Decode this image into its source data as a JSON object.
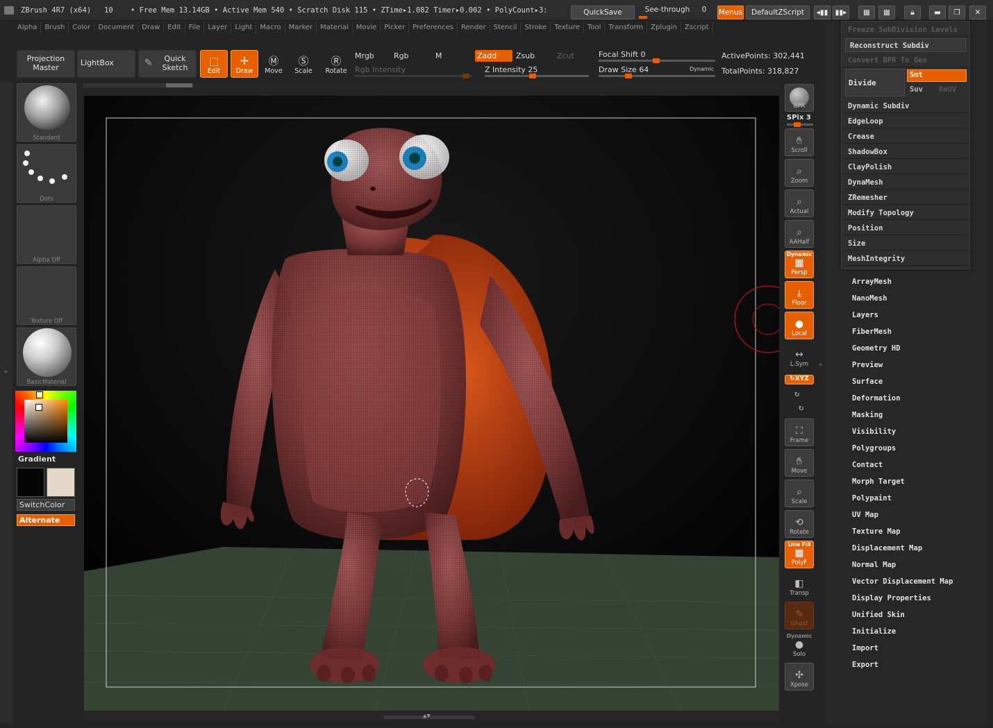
{
  "titlebar": {
    "text": "ZBrush 4R7 (x64)   10    • Free Mem 13.14GB • Active Mem 540 • Scratch Disk 115 • ZTime▸1.082 Timer▸0.002 • PolyCount▸3:",
    "quicksave": "QuickSave",
    "see_through": "See-through",
    "see_through_value": "0",
    "menus": "Menus",
    "default_zscript": "DefaultZScript"
  },
  "menubar": [
    "Alpha",
    "Brush",
    "Color",
    "Document",
    "Draw",
    "Edit",
    "File",
    "Layer",
    "Light",
    "Macro",
    "Marker",
    "Material",
    "Movie",
    "Picker",
    "Preferences",
    "Render",
    "Stencil",
    "Stroke",
    "Texture",
    "Tool",
    "Transform",
    "Zplugin",
    "Zscript"
  ],
  "toolbar": {
    "projection_master": [
      "Projection",
      "Master"
    ],
    "lightbox": "LightBox",
    "quick_sketch": [
      "Quick",
      "Sketch"
    ],
    "edit": "Edit",
    "draw": "Draw",
    "move": "Move",
    "scale": "Scale",
    "rotate": "Rotate",
    "mrgb": "Mrgb",
    "rgb": "Rgb",
    "m": "M",
    "zadd": "Zadd",
    "zsub": "Zsub",
    "zcut": "Zcut",
    "rgb_intensity": "Rgb Intensity",
    "z_intensity_label": "Z Intensity",
    "z_intensity_value": "25",
    "focal_shift_label": "Focal Shift",
    "focal_shift_value": "0",
    "draw_size_label": "Draw Size",
    "draw_size_value": "64",
    "dynamic": "Dynamic",
    "active_points_label": "ActivePoints:",
    "active_points": "302,441",
    "total_points_label": "TotalPoints:",
    "total_points": "318,827"
  },
  "leftshelf": {
    "brush": "Standard",
    "stroke": "Dots",
    "alpha": "Alpha Off",
    "texture": "Texture Off",
    "material": "BasicMaterial",
    "gradient": "Gradient",
    "switchcolor": "SwitchColor",
    "alternate": "Alternate",
    "main_color": "#050505",
    "secondary_color": "#e4d8c8"
  },
  "rightshelf": {
    "bpr": "BPR",
    "spix": "SPix 3",
    "scroll": "Scroll",
    "zoom": "Zoom",
    "actual": "Actual",
    "aahalf": "AAHalf",
    "persp_top": "Dynamic",
    "persp": "Persp",
    "floor": "Floor",
    "local": "Local",
    "lsym": "L.Sym",
    "xyz": "↻XYZ",
    "frame": "Frame",
    "move": "Move",
    "scale": "Scale",
    "rotate": "Rotate",
    "polyf_top": "Line Fill",
    "polyf": "PolyF",
    "transp": "Transp",
    "ghost": "Ghost",
    "solo_top": "Dynamic",
    "solo": "Solo",
    "xpose": "Xpose"
  },
  "geometry_menu": {
    "freeze": "Freeze SubDivision Levels",
    "reconstruct": "Reconstruct Subdiv",
    "convert": "Convert BPR To Geo",
    "divide": "Divide",
    "smt": "Smt",
    "suv": "Suv",
    "reuv": "ReUV",
    "items": [
      "Dynamic Subdiv",
      "EdgeLoop",
      "Crease",
      "ShadowBox",
      "ClayPolish",
      "DynaMesh",
      "ZRemesher",
      "Modify Topology",
      "Position",
      "Size",
      "MeshIntegrity"
    ]
  },
  "tool_subpalettes": [
    "ArrayMesh",
    "NanoMesh",
    "Layers",
    "FiberMesh",
    "Geometry HD",
    "Preview",
    "Surface",
    "Deformation",
    "Masking",
    "Visibility",
    "Polygroups",
    "Contact",
    "Morph Target",
    "Polypaint",
    "UV Map",
    "Texture Map",
    "Displacement Map",
    "Normal Map",
    "Vector Displacement Map",
    "Display Properties",
    "Unified Skin",
    "Initialize",
    "Import",
    "Export"
  ],
  "colors": {
    "accent": "#e85f00",
    "panel": "#272727",
    "model": "#8a3f3f",
    "shell": "#c2420f",
    "floor": "#3c4a3c"
  }
}
